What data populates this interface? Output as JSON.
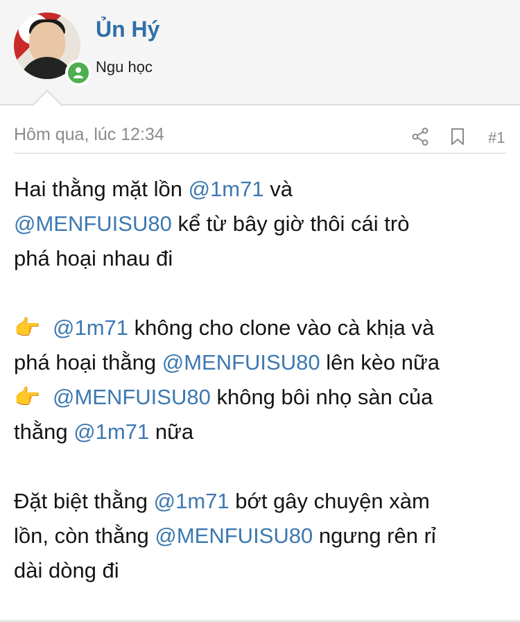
{
  "author": {
    "name": "Ủn Hý",
    "title": "Ngu học",
    "avatar_icon": "avatar-photo",
    "status_icon": "user-online-icon",
    "status_color": "#4caf50"
  },
  "post": {
    "timestamp": "Hôm qua, lúc 12:34",
    "number": "#1",
    "actions": [
      "share-icon",
      "bookmark-icon"
    ],
    "mention_color": "#3c78b0",
    "paragraphs": {
      "p1": {
        "l1": {
          "t1": "Hai thằng mặt lồn ",
          "m1": "@1m71",
          "t2": " và"
        },
        "l2": {
          "m1": "@MENFUISU80",
          "t1": " kể từ bây giờ thôi cái trò"
        },
        "l3": {
          "t1": "phá hoại nhau đi"
        }
      },
      "p2": {
        "l1": {
          "icon": "👉",
          "m1": "@1m71",
          "t1": " không cho clone vào cà khịa và"
        },
        "l2": {
          "t1": "phá hoại thằng ",
          "m1": "@MENFUISU80",
          "t2": " lên kèo nữa"
        },
        "l3": {
          "icon": "👉",
          "m1": "@MENFUISU80",
          "t1": " không bôi nhọ sàn của"
        },
        "l4": {
          "t1": "thằng ",
          "m1": "@1m71",
          "t2": " nữa"
        }
      },
      "p3": {
        "l1": {
          "t1": "Đặt biệt thằng ",
          "m1": "@1m71",
          "t2": " bớt gây chuyện xàm"
        },
        "l2": {
          "t1": "lồn, còn thằng ",
          "m1": "@MENFUISU80",
          "t2": " ngưng rên rỉ"
        },
        "l3": {
          "t1": "dài dòng đi"
        }
      }
    }
  }
}
